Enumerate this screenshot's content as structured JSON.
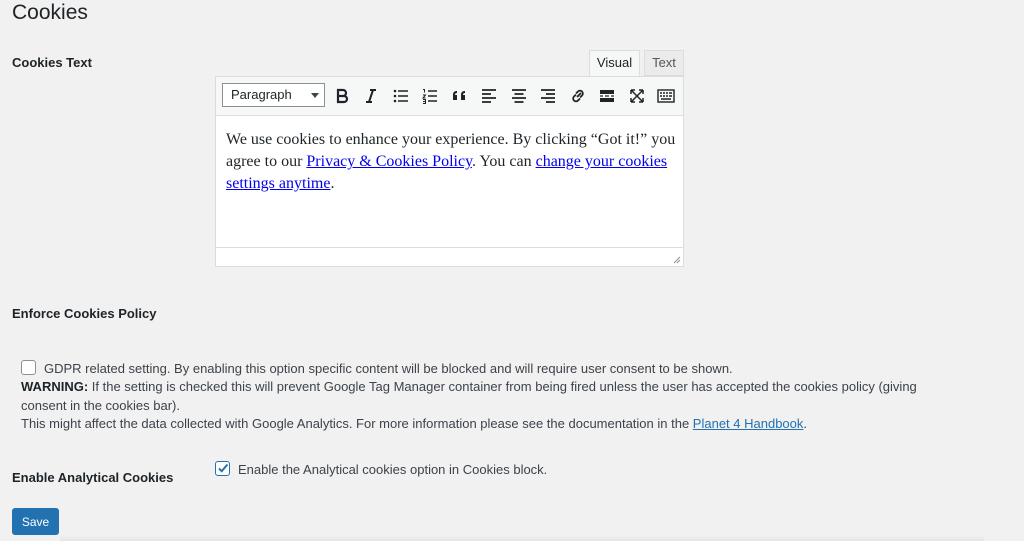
{
  "page": {
    "title": "Cookies"
  },
  "cookies_text": {
    "label": "Cookies Text",
    "tabs": {
      "visual": "Visual",
      "text": "Text"
    },
    "format_select": {
      "value": "Paragraph",
      "icon": "chevron-down-icon"
    },
    "toolbar_icons": [
      "bold-icon",
      "italic-icon",
      "bulleted-list-icon",
      "numbered-list-icon",
      "blockquote-icon",
      "align-left-icon",
      "align-center-icon",
      "align-right-icon",
      "link-icon",
      "read-more-icon",
      "fullscreen-icon",
      "toolbar-toggle-icon"
    ],
    "content": {
      "part1": "We use cookies to enhance your experience. By clicking “Got it!” you agree to our ",
      "link1": "Privacy & Cookies Policy",
      "part2": ". You can ",
      "link2": "change your cookies settings anytime",
      "part3": "."
    }
  },
  "enforce": {
    "label": "Enforce Cookies Policy",
    "checked": false,
    "line1": "GDPR related setting. By enabling this option specific content will be blocked and will require user consent to be shown.",
    "warning_label": "WARNING:",
    "warning_line1": " If the setting is checked this will prevent Google Tag Manager container from being fired unless the user has accepted the cookies policy (giving",
    "warning_line2": "consent in the cookies bar).",
    "line3_prefix": "This might affect the data collected with Google Analytics. For more information please see the documentation in the ",
    "handbook_link": "Planet 4 Handbook",
    "line3_suffix": "."
  },
  "analytical": {
    "label": "Enable Analytical Cookies",
    "checked": true,
    "text": "Enable the Analytical cookies option in Cookies block."
  },
  "save_label": "Save",
  "colors": {
    "primary": "#2271b1",
    "link": "#0000ee",
    "background": "#f1f1f1"
  }
}
